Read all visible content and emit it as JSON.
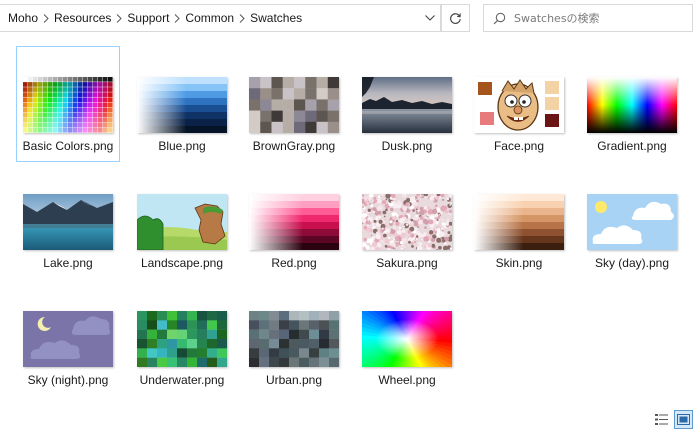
{
  "breadcrumb": [
    "Moho",
    "Resources",
    "Support",
    "Common",
    "Swatches"
  ],
  "search": {
    "placeholder": "Swatchesの検索"
  },
  "files": [
    {
      "name": "Basic Colors.png",
      "thumb": "basic-colors",
      "selected": true
    },
    {
      "name": "Blue.png",
      "thumb": "blue"
    },
    {
      "name": "BrownGray.png",
      "thumb": "browngray"
    },
    {
      "name": "Dusk.png",
      "thumb": "dusk"
    },
    {
      "name": "Face.png",
      "thumb": "face"
    },
    {
      "name": "Gradient.png",
      "thumb": "gradient"
    },
    {
      "name": "Lake.png",
      "thumb": "lake"
    },
    {
      "name": "Landscape.png",
      "thumb": "landscape"
    },
    {
      "name": "Red.png",
      "thumb": "red"
    },
    {
      "name": "Sakura.png",
      "thumb": "sakura"
    },
    {
      "name": "Skin.png",
      "thumb": "skin"
    },
    {
      "name": "Sky (day).png",
      "thumb": "sky-day"
    },
    {
      "name": "Sky (night).png",
      "thumb": "sky-night"
    },
    {
      "name": "Underwater.png",
      "thumb": "underwater"
    },
    {
      "name": "Urban.png",
      "thumb": "urban"
    },
    {
      "name": "Wheel.png",
      "thumb": "wheel"
    }
  ],
  "view": {
    "active": "large-icons"
  },
  "icons": {
    "breadcrumb_separator": "chevron-right-icon",
    "address_dropdown": "chevron-down-icon",
    "refresh": "refresh-icon",
    "search": "search-icon",
    "details_view": "details-view-icon",
    "large_icons_view": "large-icons-view-icon"
  },
  "colors": {
    "selection_border": "#99d1ff",
    "view_active": "#d5e8f8"
  }
}
